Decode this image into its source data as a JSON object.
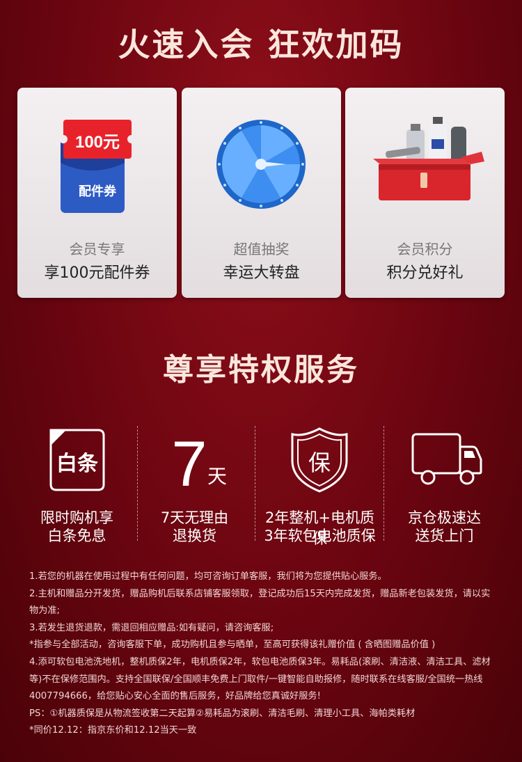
{
  "header": {
    "title": "火速入会 狂欢加码"
  },
  "cards": [
    {
      "sub": "会员专享",
      "main": "享100元配件券",
      "art": {
        "amount": "100元",
        "label": "配件券",
        "icon": "coupon-icon"
      }
    },
    {
      "sub": "超值抽奖",
      "main": "幸运大转盘",
      "art": {
        "icon": "wheel-icon"
      }
    },
    {
      "sub": "会员积分",
      "main": "积分兑好礼",
      "art": {
        "icon": "gift-box-icon"
      }
    }
  ],
  "services_title": "尊享特权服务",
  "services": [
    {
      "icon": "baitiao-icon",
      "icon_text": "白条",
      "line1": "限时购机享",
      "line2": "白条免息"
    },
    {
      "icon": "seven-day-icon",
      "icon_text": "7",
      "icon_text2": "天",
      "line1": "7天无理由",
      "line2": "退换货"
    },
    {
      "icon": "shield-icon",
      "icon_text": "保",
      "line1": "2年整机+电机质保",
      "line2": "3年软包电池质保"
    },
    {
      "icon": "truck-icon",
      "line1": "京仓极速达",
      "line2": "送货上门"
    }
  ],
  "notes": [
    "1.若您的机器在使用过程中有任何问题，均可咨询订单客服，我们将为您提供贴心服务。",
    "2.主机和赠品分开发货，赠品购机后联系店铺客服领取，登记成功后15天内完成发货，赠品新老包装发货，请以实物为准;",
    "3.若发生退货退款，需退回相应赠品:如有疑问，请咨询客服;",
    "*指参与全部活动，咨询客服下单，成功购机且参与晒单，至高可获得该礼赠价值 ( 含晒图赠品价值 )",
    "4.添可软包电池洗地机，整机质保2年，电机质保2年，软包电池质保3年。易耗品(滚刷、清洁液、清洁工具、滤材等)不在保修范围内。支持全国联保/全国顺丰免费上门取件/一键智能自助报修，随时联系在线客服/全国统一热线4007794666，给您贴心安心全面的售后服务，好品牌给您真诚好服务!",
    "PS：①机器质保是从物流签收第二天起算②易耗品为滚刷、清洁毛刷、清理小工具、海帕类耗材",
    "*同价12.12：指京东价和12.12当天一致"
  ],
  "colors": {
    "bg": "#6a0510",
    "title": "#fbe6dc",
    "coupon_red": "#e8222b",
    "coupon_blue": "#2d5bc4",
    "wheel_blue": "#2f7fe0",
    "box_red": "#d8262c"
  }
}
